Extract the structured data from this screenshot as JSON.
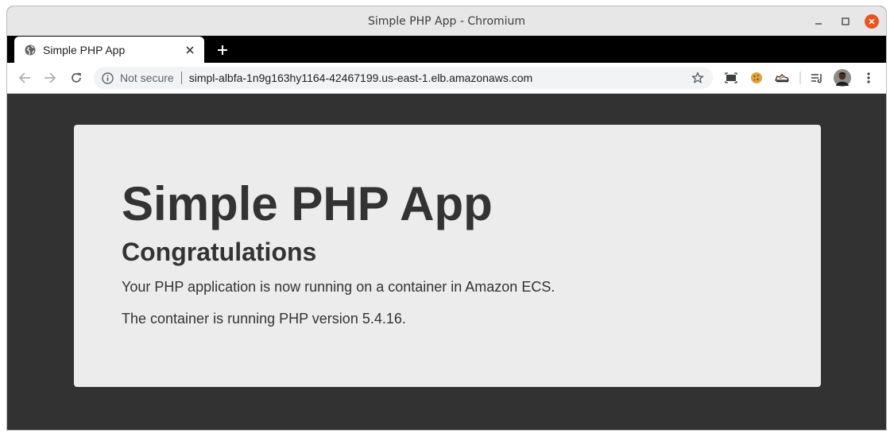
{
  "window": {
    "title": "Simple PHP App - Chromium",
    "close_color": "#e95420"
  },
  "tab": {
    "title": "Simple PHP App"
  },
  "omnibox": {
    "security_label": "Not secure",
    "url": "simpl-albfa-1n9g163hy1164-42467199.us-east-1.elb.amazonaws.com"
  },
  "extensions": [
    "screen-capture-icon",
    "cookie-icon",
    "sneaker-icon",
    "reading-list-icon",
    "profile-avatar",
    "menu-icon"
  ],
  "page": {
    "heading": "Simple PHP App",
    "subheading": "Congratulations",
    "line1": "Your PHP application is now running on a container in Amazon ECS.",
    "line2": "The container is running PHP version 5.4.16.",
    "background_color": "#323232",
    "card_color": "#ececec",
    "text_color": "#333333"
  }
}
